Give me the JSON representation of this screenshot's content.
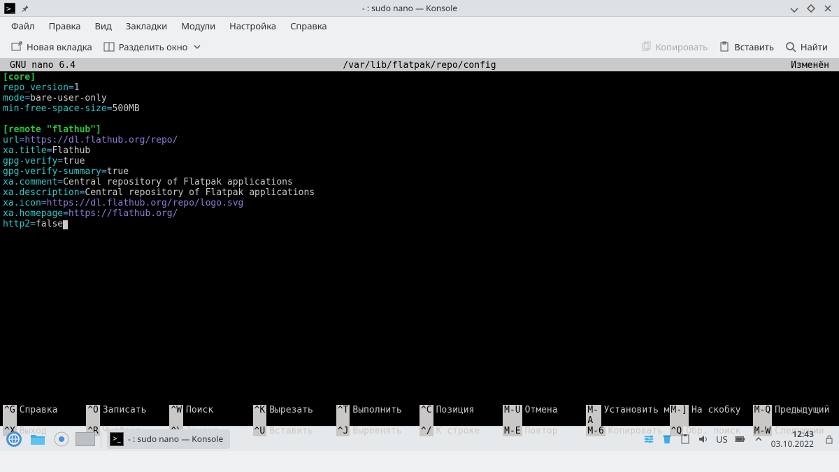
{
  "window": {
    "title": "- : sudo nano — Konsole"
  },
  "menubar": [
    "Файл",
    "Правка",
    "Вид",
    "Закладки",
    "Модули",
    "Настройка",
    "Справка"
  ],
  "toolbar": {
    "newtab": "Новая вкладка",
    "split": "Разделить окно",
    "copy": "Копировать",
    "paste": "Вставить",
    "find": "Найти"
  },
  "nano": {
    "version": "GNU  nano 6.4",
    "path": "/var/lib/flatpak/repo/config",
    "status": "Изменён",
    "content": {
      "section1": "[core]",
      "lines1": [
        {
          "k": "repo_version",
          "v": "1"
        },
        {
          "k": "mode",
          "v": "bare-user-only"
        },
        {
          "k": "min-free-space-size",
          "v": "500MB"
        }
      ],
      "section2": "[remote \"flathub\"]",
      "lines2": [
        {
          "k": "url",
          "u": "https://dl.flathub.org/repo/"
        },
        {
          "k": "xa.title",
          "v": "Flathub"
        },
        {
          "k": "gpg-verify",
          "v": "true"
        },
        {
          "k": "gpg-verify-summary",
          "v": "true"
        },
        {
          "k": "xa.comment",
          "v": "Central repository of Flatpak applications"
        },
        {
          "k": "xa.description",
          "v": "Central repository of Flatpak applications"
        },
        {
          "k": "xa.icon",
          "u": "https://dl.flathub.org/repo/logo.svg"
        },
        {
          "k": "xa.homepage",
          "u": "https://flathub.org/"
        },
        {
          "k": "http2",
          "v": "false",
          "cursor": true
        }
      ]
    },
    "shortcuts": {
      "row1": [
        {
          "k": "^G",
          "l": "Справка"
        },
        {
          "k": "^O",
          "l": "Записать"
        },
        {
          "k": "^W",
          "l": "Поиск"
        },
        {
          "k": "^K",
          "l": "Вырезать"
        },
        {
          "k": "^T",
          "l": "Выполнить"
        },
        {
          "k": "^C",
          "l": "Позиция"
        },
        {
          "k": "M-U",
          "l": "Отмена"
        },
        {
          "k": "M-A",
          "l": "Установить м"
        },
        {
          "k": "M-]",
          "l": "На скобку"
        },
        {
          "k": "M-Q",
          "l": "Предыдущий"
        }
      ],
      "row2": [
        {
          "k": "^X",
          "l": "Выход"
        },
        {
          "k": "^R",
          "l": "ЧитФайл"
        },
        {
          "k": "^\\",
          "l": "Замена"
        },
        {
          "k": "^U",
          "l": "Вставить"
        },
        {
          "k": "^J",
          "l": "Выровнять"
        },
        {
          "k": "^/",
          "l": "К строке"
        },
        {
          "k": "M-E",
          "l": "Повтор"
        },
        {
          "k": "M-6",
          "l": "Копировать"
        },
        {
          "k": "^Q",
          "l": "Обр. поиск"
        },
        {
          "k": "M-W",
          "l": "Следующий"
        }
      ]
    }
  },
  "taskbar": {
    "task": "- : sudo nano — Konsole",
    "lang": "US",
    "time": "12:43",
    "date": "03.10.2022"
  }
}
